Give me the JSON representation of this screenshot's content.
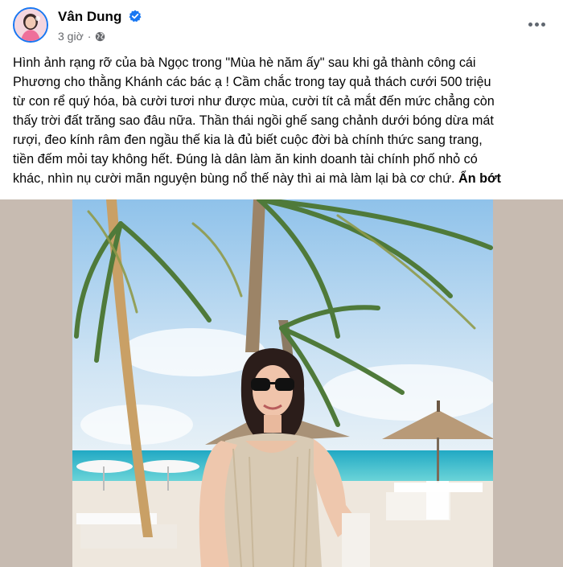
{
  "post": {
    "author": "Vân Dung",
    "time": "3 giờ",
    "separator": "·",
    "text_lines": [
      "Hình ảnh rạng rỡ của bà Ngọc trong \"Mùa hè năm ấy\" sau khi gả thành công cái",
      "Phương cho thằng Khánh các bác ạ ! Cầm chắc trong tay quả thách cưới 500 triệu",
      "từ con rể quý hóa, bà cười tươi như được mùa, cười tít cả mắt đến mức chẳng còn",
      "thấy trời đất trăng sao đâu nữa. Thần thái ngồi ghế sang chảnh dưới bóng dừa mát",
      "rượi, đeo kính râm đen ngầu thế kia là đủ biết cuộc đời bà chính thức sang trang,",
      "tiền đếm mỏi tay không hết. Đúng là dân làm ăn kinh doanh tài chính phố nhỏ có"
    ],
    "last_line": "khác, nhìn nụ cười mãn nguyện bùng nổ thế này thì ai mà làm lại bà cơ chứ.",
    "see_less": "Ẩn bớt"
  },
  "icons": {
    "verified": "verified-badge-icon",
    "audience": "globe-icon",
    "more": "more-options-icon"
  },
  "colors": {
    "accent": "#1877f2",
    "secondary_text": "#65676b",
    "photo_backdrop": "#c7bbb1"
  }
}
